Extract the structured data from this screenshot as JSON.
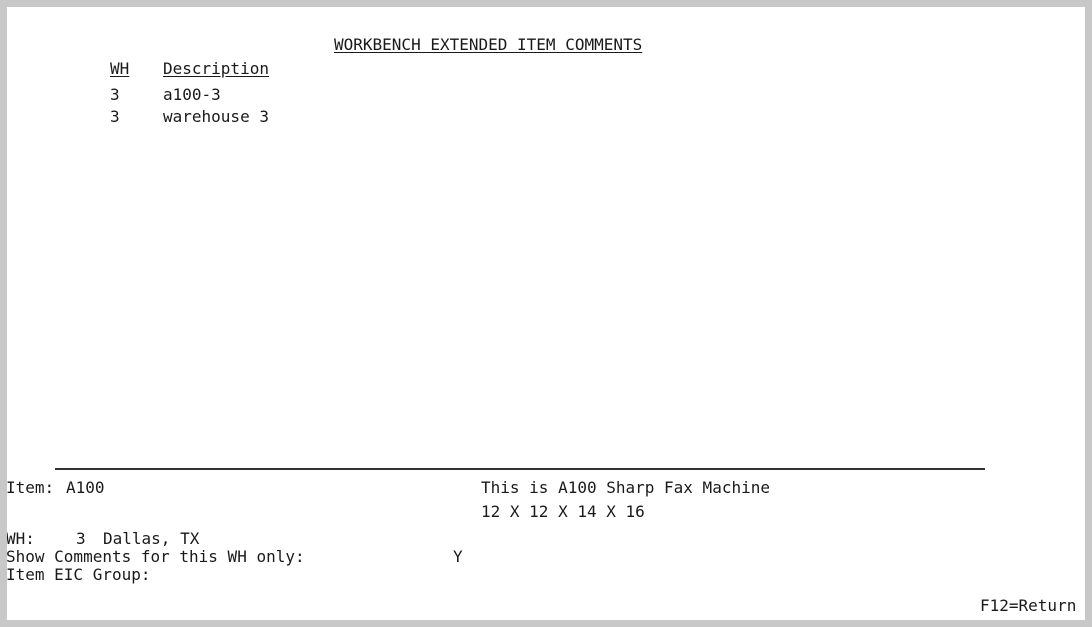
{
  "header": {
    "title": "WORKBENCH EXTENDED ITEM COMMENTS"
  },
  "list": {
    "columns": [
      "WH",
      "Description"
    ],
    "rows": [
      {
        "wh": "3",
        "description": "a100-3"
      },
      {
        "wh": "3",
        "description": "warehouse 3"
      }
    ]
  },
  "footer": {
    "item_label": "Item:",
    "item_value": "A100",
    "item_description": "This is A100 Sharp Fax Machine",
    "item_dimensions": "12 X 12 X 14 X 16",
    "wh_label": "WH:",
    "wh_value": "3",
    "wh_name": "Dallas, TX",
    "show_comments_label": "Show Comments for this WH only:",
    "show_comments_value": "Y",
    "eic_group_label": "Item EIC Group:",
    "eic_group_value": "",
    "function_key": "F12=Return"
  }
}
